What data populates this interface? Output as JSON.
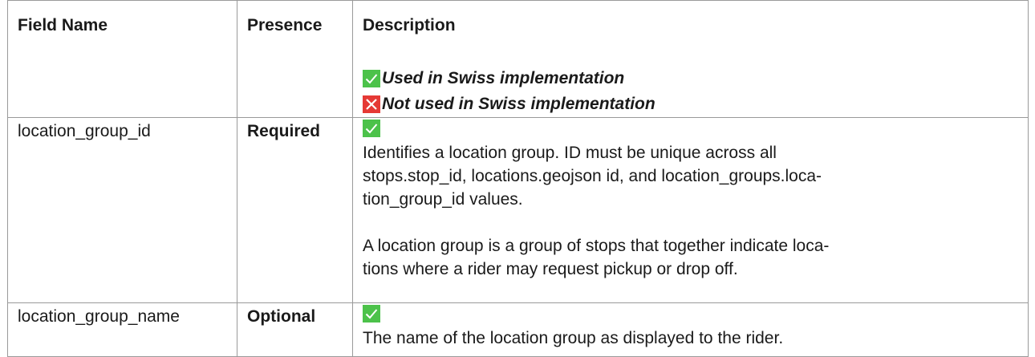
{
  "header": {
    "field_name": "Field Name",
    "presence": "Presence",
    "description": "Description",
    "legend_used": "Used in Swiss implementation",
    "legend_not_used": "Not used in Swiss implementation"
  },
  "rows": [
    {
      "field": "location_group_id",
      "presence": "Required",
      "status_icon": "check-icon",
      "desc_p1_l1": "Identifies a location group. ID must be unique across all",
      "desc_p1_l2": "stops.stop_id, locations.geojson id, and location_groups.loca-",
      "desc_p1_l3": "tion_group_id values.",
      "desc_p2_l1": "A location group is a group of stops that together indicate loca-",
      "desc_p2_l2": "tions where a rider may request pickup or drop off."
    },
    {
      "field": "location_group_name",
      "presence": "Optional",
      "status_icon": "check-icon",
      "desc_l1": "The name of the location group as displayed to the rider."
    }
  ],
  "colors": {
    "check_green": "#4cc24a",
    "cross_red": "#e53935",
    "border": "#9a9a9a"
  }
}
